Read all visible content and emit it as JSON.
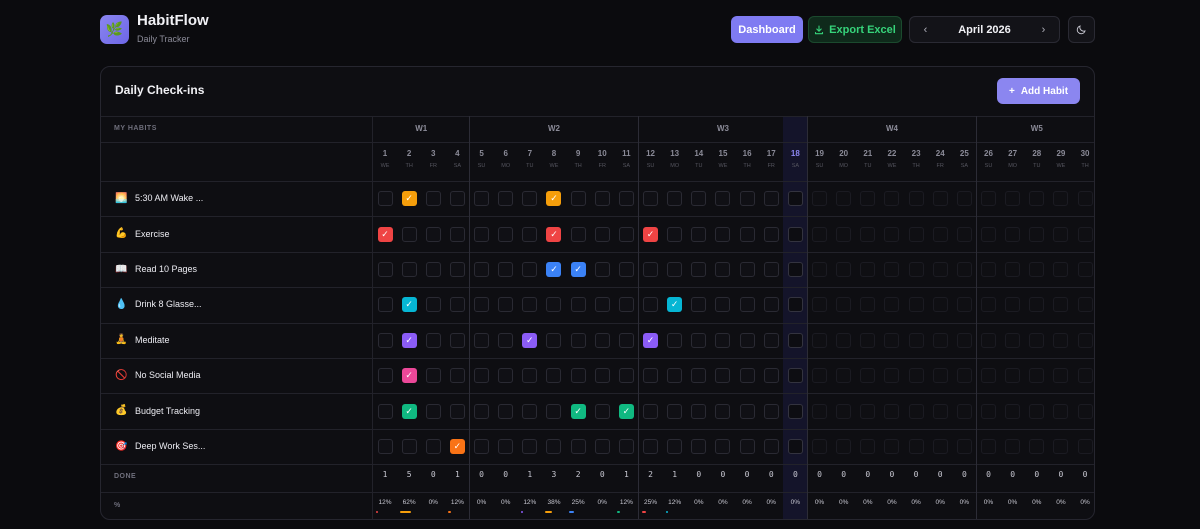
{
  "app": {
    "name": "HabitFlow",
    "subtitle": "Daily Tracker",
    "logo_icon": "leaf"
  },
  "toolbar": {
    "dashboard_label": "Dashboard",
    "export_label": "Export Excel",
    "month_label": "April 2026",
    "theme_icon": "moon-icon"
  },
  "card": {
    "title": "Daily Check-ins",
    "add_label": "Add Habit"
  },
  "table": {
    "habits_header": "MY HABITS",
    "done_label": "DONE",
    "pct_label": "%",
    "today": 18,
    "weeks": [
      {
        "label": "W1",
        "start": 1,
        "end": 4
      },
      {
        "label": "W2",
        "start": 5,
        "end": 11
      },
      {
        "label": "W3",
        "start": 12,
        "end": 18
      },
      {
        "label": "W4",
        "start": 19,
        "end": 25
      },
      {
        "label": "W5",
        "start": 26,
        "end": 30
      }
    ],
    "days": [
      {
        "n": "1",
        "d": "WE"
      },
      {
        "n": "2",
        "d": "TH"
      },
      {
        "n": "3",
        "d": "FR"
      },
      {
        "n": "4",
        "d": "SA"
      },
      {
        "n": "5",
        "d": "SU"
      },
      {
        "n": "6",
        "d": "MO"
      },
      {
        "n": "7",
        "d": "TU"
      },
      {
        "n": "8",
        "d": "WE"
      },
      {
        "n": "9",
        "d": "TH"
      },
      {
        "n": "10",
        "d": "FR"
      },
      {
        "n": "11",
        "d": "SA"
      },
      {
        "n": "12",
        "d": "SU"
      },
      {
        "n": "13",
        "d": "MO"
      },
      {
        "n": "14",
        "d": "TU"
      },
      {
        "n": "15",
        "d": "WE"
      },
      {
        "n": "16",
        "d": "TH"
      },
      {
        "n": "17",
        "d": "FR"
      },
      {
        "n": "18",
        "d": "SA"
      },
      {
        "n": "19",
        "d": "SU"
      },
      {
        "n": "20",
        "d": "MO"
      },
      {
        "n": "21",
        "d": "TU"
      },
      {
        "n": "22",
        "d": "WE"
      },
      {
        "n": "23",
        "d": "TH"
      },
      {
        "n": "24",
        "d": "FR"
      },
      {
        "n": "25",
        "d": "SA"
      },
      {
        "n": "26",
        "d": "SU"
      },
      {
        "n": "27",
        "d": "MO"
      },
      {
        "n": "28",
        "d": "TU"
      },
      {
        "n": "29",
        "d": "WE"
      },
      {
        "n": "30",
        "d": "TH"
      }
    ],
    "habits": [
      {
        "icon": "🌅",
        "name": "5:30 AM Wake ...",
        "color": "#f59e0b",
        "checked": [
          2,
          8
        ]
      },
      {
        "icon": "💪",
        "name": "Exercise",
        "color": "#ef4444",
        "checked": [
          1,
          8,
          12
        ]
      },
      {
        "icon": "📖",
        "name": "Read 10 Pages",
        "color": "#3b82f6",
        "checked": [
          8,
          9
        ]
      },
      {
        "icon": "💧",
        "name": "Drink 8 Glasse...",
        "color": "#06b6d4",
        "checked": [
          2,
          13
        ]
      },
      {
        "icon": "🧘",
        "name": "Meditate",
        "color": "#8b5cf6",
        "checked": [
          2,
          7,
          12
        ]
      },
      {
        "icon": "🚫",
        "name": "No Social Media",
        "color": "#ec4899",
        "checked": [
          2
        ]
      },
      {
        "icon": "💰",
        "name": "Budget Tracking",
        "color": "#10b981",
        "checked": [
          2,
          9,
          11
        ]
      },
      {
        "icon": "🎯",
        "name": "Deep Work Ses...",
        "color": "#f97316",
        "checked": [
          4
        ]
      }
    ],
    "done": [
      "1",
      "5",
      "0",
      "1",
      "0",
      "0",
      "1",
      "3",
      "2",
      "0",
      "1",
      "2",
      "1",
      "0",
      "0",
      "0",
      "0",
      "0",
      "0",
      "0",
      "0",
      "0",
      "0",
      "0",
      "0",
      "0",
      "0",
      "0",
      "0",
      "0"
    ],
    "pct": [
      "12%",
      "62%",
      "0%",
      "12%",
      "0%",
      "0%",
      "12%",
      "38%",
      "25%",
      "0%",
      "12%",
      "25%",
      "12%",
      "0%",
      "0%",
      "0%",
      "0%",
      "0%",
      "0%",
      "0%",
      "0%",
      "0%",
      "0%",
      "0%",
      "0%",
      "0%",
      "0%",
      "0%",
      "0%",
      "0%"
    ]
  }
}
